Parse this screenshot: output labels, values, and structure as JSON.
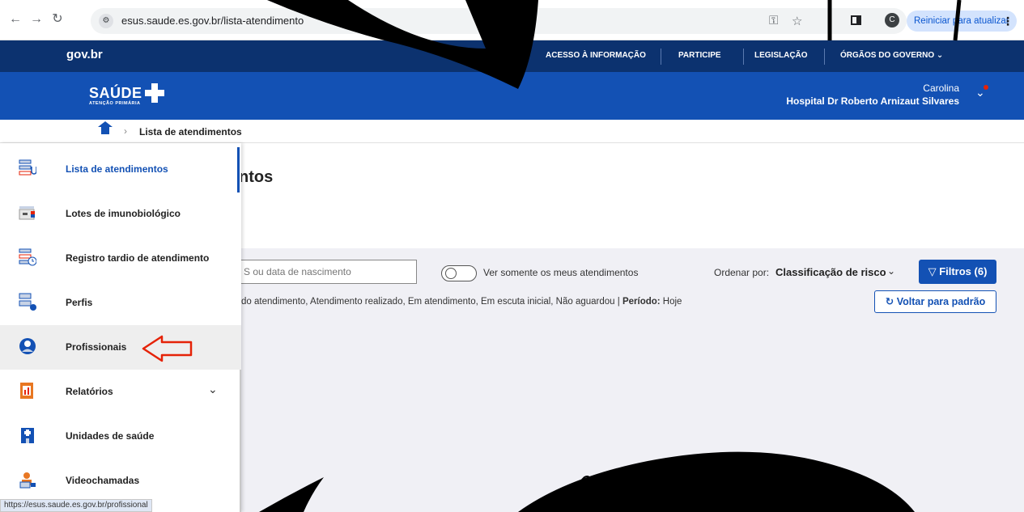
{
  "browser": {
    "url": "esus.saude.es.gov.br/lista-atendimento",
    "update_button": "Reiniciar para atualizar",
    "profile_initial": "C",
    "status_url": "https://esus.saude.es.gov.br/profissional"
  },
  "govbar": {
    "logo": "gov.br",
    "links": [
      "ACESSO À INFORMAÇÃO",
      "PARTICIPE",
      "LEGISLAÇÃO",
      "ÓRGÃOS DO GOVERNO"
    ]
  },
  "header": {
    "logo_text": "SAÚDE",
    "logo_subtitle": "ATENÇÃO PRIMÁRIA",
    "user_name": "Carolina",
    "user_unit": "Hospital Dr Roberto Arnizaut Silvares"
  },
  "breadcrumb": {
    "current": "Lista de atendimentos"
  },
  "main": {
    "title": "Lista de atendimentos",
    "title_visible": "ntos",
    "search_placeholder": "S ou data de nascimento",
    "toggle_label": "Ver somente os meus atendimentos",
    "sort_label": "Ordenar por:",
    "sort_value": "Classificação de risco",
    "filters_button": "Filtros (6)",
    "filter_summary": "do atendimento, Atendimento realizado, Em atendimento, Em escuta inicial, Não aguardou |",
    "period_label": "Período:",
    "period_value": "Hoje",
    "reset_button": "Voltar para padrão"
  },
  "sidebar": {
    "items": [
      {
        "label": "Lista de atendimentos",
        "icon": "list-attendance-icon"
      },
      {
        "label": "Lotes de imunobiológico",
        "icon": "vaccine-batch-icon"
      },
      {
        "label": "Registro tardio de atendimento",
        "icon": "late-record-icon"
      },
      {
        "label": "Perfis",
        "icon": "profiles-icon"
      },
      {
        "label": "Profissionais",
        "icon": "professionals-icon"
      },
      {
        "label": "Relatórios",
        "icon": "reports-icon"
      },
      {
        "label": "Unidades de saúde",
        "icon": "health-unit-icon"
      },
      {
        "label": "Videochamadas",
        "icon": "video-call-icon"
      }
    ]
  },
  "colors": {
    "gov_blue": "#0c326f",
    "brand_blue": "#1351b4",
    "annotation_red": "#e52207"
  }
}
